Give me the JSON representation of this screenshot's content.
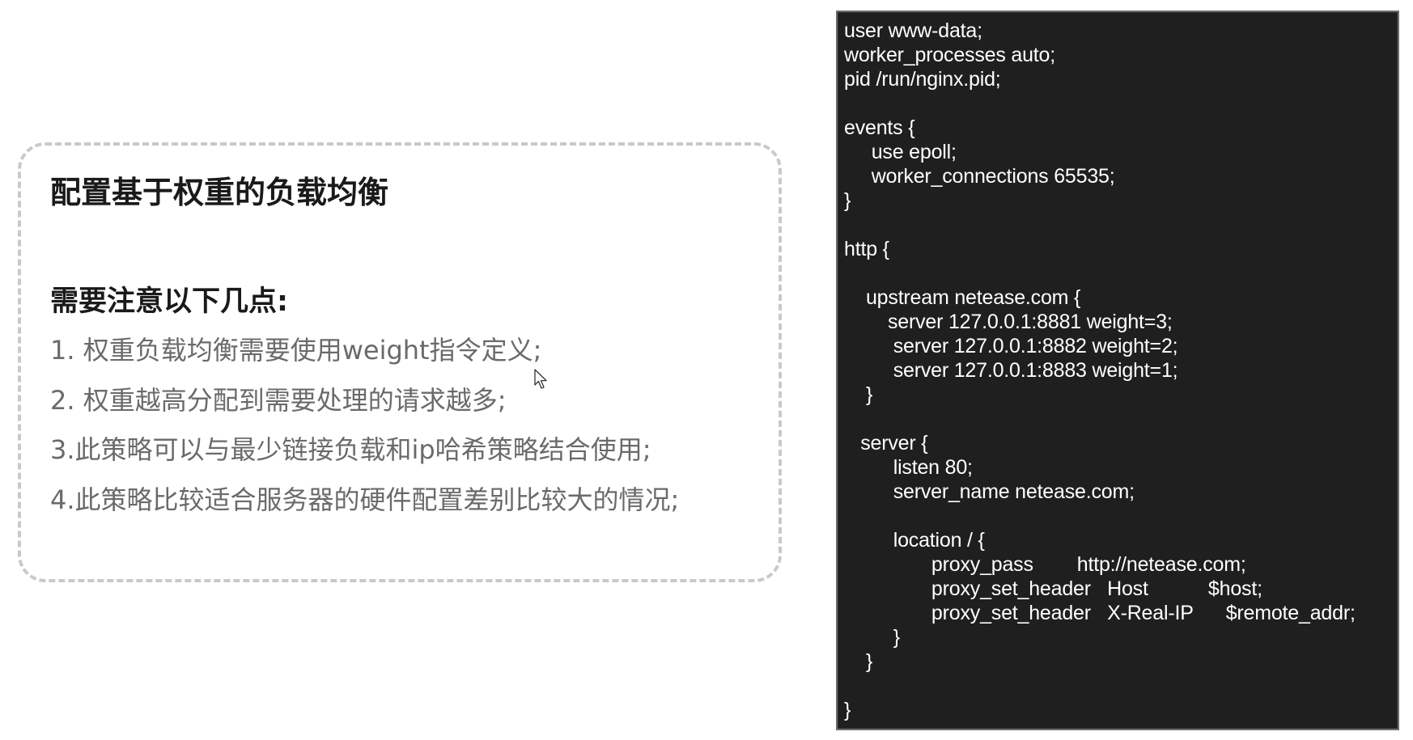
{
  "card": {
    "title": "配置基于权重的负载均衡",
    "subtitle": "需要注意以下几点:",
    "items": [
      "1. 权重负载均衡需要使用weight指令定义;",
      "2. 权重越高分配到需要处理的请求越多;",
      "3.此策略可以与最少链接负载和ip哈希策略结合使用;",
      "4.此策略比较适合服务器的硬件配置差别比较大的情况;"
    ]
  },
  "code": {
    "text": "user www-data;\nworker_processes auto;\npid /run/nginx.pid;\n\nevents {\n     use epoll;\n     worker_connections 65535;\n}\n\nhttp {\n\n    upstream netease.com {\n        server 127.0.0.1:8881 weight=3;\n         server 127.0.0.1:8882 weight=2;\n         server 127.0.0.1:8883 weight=1;\n    }\n\n   server {\n         listen 80;\n         server_name netease.com;\n\n         location / {\n                proxy_pass        http://netease.com;\n                proxy_set_header   Host           $host;\n                proxy_set_header   X-Real-IP      $remote_addr;\n         }\n    }\n\n}"
  },
  "colors": {
    "code_background": "#1f1f1f",
    "code_text": "#ffffff",
    "card_border": "#c9c9c9",
    "list_text": "#6a6a6a",
    "heading_text": "#1a1a1a"
  },
  "icons": {
    "cursor": "mouse-pointer-icon"
  }
}
